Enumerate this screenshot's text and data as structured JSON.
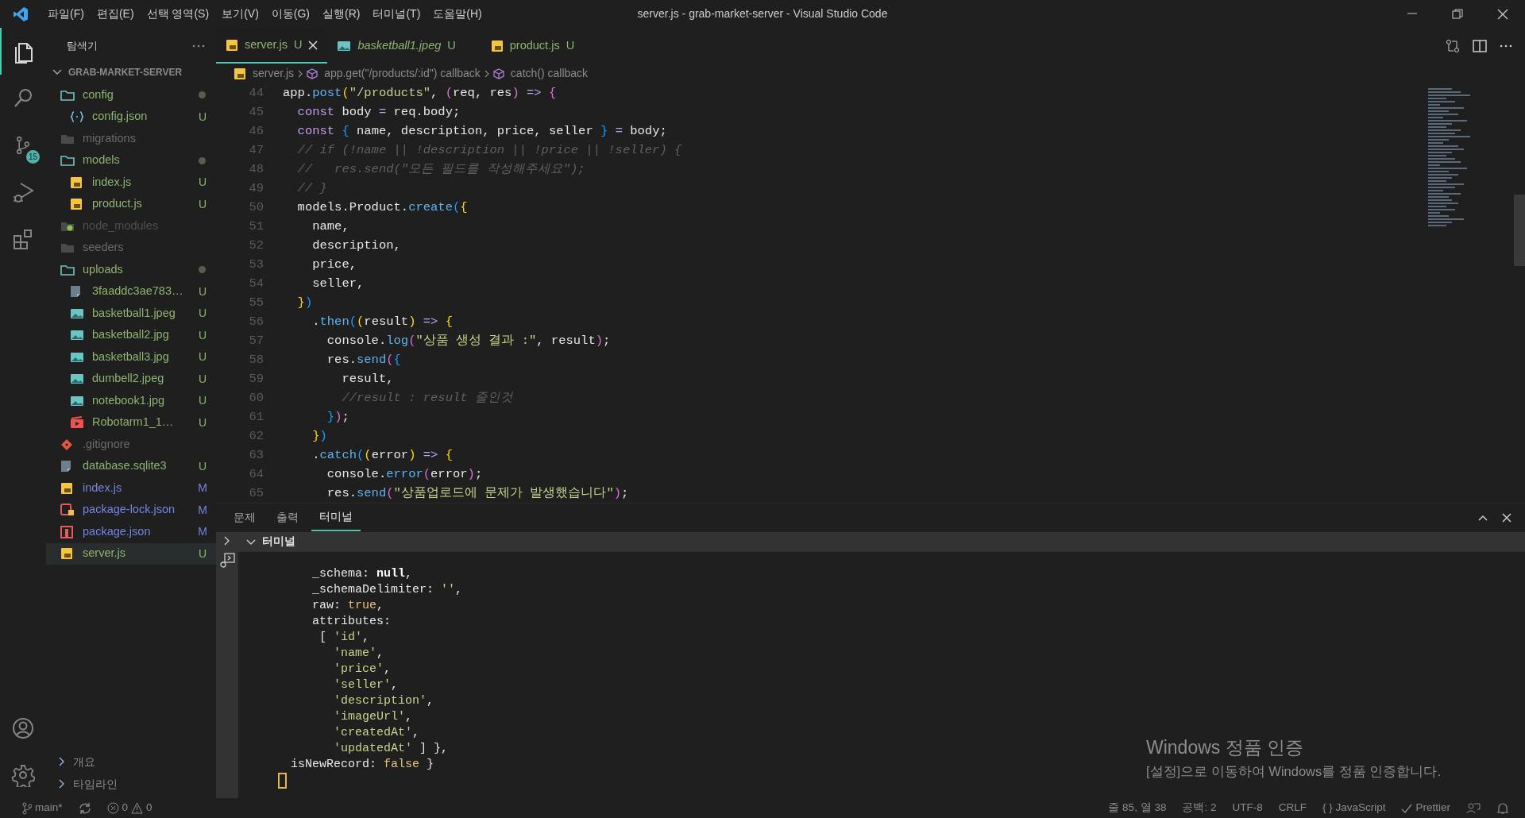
{
  "window": {
    "title": "server.js - grab-market-server - Visual Studio Code"
  },
  "menu": [
    "파일(F)",
    "편집(E)",
    "선택 영역(S)",
    "보기(V)",
    "이동(G)",
    "실행(R)",
    "터미널(T)",
    "도움말(H)"
  ],
  "activity_bar": {
    "items": [
      {
        "kind": "explorer",
        "selected": true
      },
      {
        "kind": "search",
        "selected": false
      },
      {
        "kind": "source-control",
        "selected": false,
        "badge": "15"
      },
      {
        "kind": "run-debug",
        "selected": false
      },
      {
        "kind": "extensions",
        "selected": false
      }
    ],
    "bottom": [
      {
        "kind": "account"
      },
      {
        "kind": "settings"
      }
    ]
  },
  "sidebar": {
    "title": "탐색기",
    "root": {
      "label": "GRAB-MARKET-SERVER",
      "expanded": true
    },
    "items": [
      {
        "name": "config",
        "kind": "folder",
        "expanded": true,
        "color": "#8db46f",
        "dot": true,
        "selected": false,
        "children": [
          {
            "name": "config.json",
            "kind": "json",
            "color": "#8db46f",
            "badge": "U",
            "dot": false,
            "selected": false
          }
        ]
      },
      {
        "name": "migrations",
        "kind": "folder",
        "expanded": false,
        "color": "#6a6a6a",
        "dot": false,
        "selected": false
      },
      {
        "name": "models",
        "kind": "folder",
        "expanded": true,
        "color": "#8db46f",
        "dot": true,
        "selected": false,
        "children": [
          {
            "name": "index.js",
            "kind": "js",
            "color": "#8db46f",
            "badge": "U",
            "dot": false,
            "selected": false
          },
          {
            "name": "product.js",
            "kind": "js",
            "color": "#8db46f",
            "badge": "U",
            "dot": false,
            "selected": false
          }
        ]
      },
      {
        "name": "node_modules",
        "kind": "node-folder",
        "expanded": false,
        "color": "#4f4f4f",
        "dot": false,
        "selected": false
      },
      {
        "name": "seeders",
        "kind": "folder",
        "expanded": false,
        "color": "#6a6a6a",
        "dot": false,
        "selected": false
      },
      {
        "name": "uploads",
        "kind": "folder",
        "expanded": true,
        "color": "#8db46f",
        "dot": true,
        "selected": false,
        "children": [
          {
            "name": "3faaddc3ae783…",
            "kind": "file",
            "color": "#8db46f",
            "badge": "U",
            "dot": false,
            "selected": false
          },
          {
            "name": "basketball1.jpeg",
            "kind": "image",
            "color": "#8db46f",
            "badge": "U",
            "dot": false,
            "selected": false
          },
          {
            "name": "basketball2.jpg",
            "kind": "image",
            "color": "#8db46f",
            "badge": "U",
            "dot": false,
            "selected": false
          },
          {
            "name": "basketball3.jpg",
            "kind": "image",
            "color": "#8db46f",
            "badge": "U",
            "dot": false,
            "selected": false
          },
          {
            "name": "dumbell2.jpeg",
            "kind": "image",
            "color": "#8db46f",
            "badge": "U",
            "dot": false,
            "selected": false
          },
          {
            "name": "notebook1.jpg",
            "kind": "image",
            "color": "#8db46f",
            "badge": "U",
            "dot": false,
            "selected": false
          },
          {
            "name": "Robotarm1_1…",
            "kind": "video",
            "color": "#8db46f",
            "badge": "U",
            "dot": false,
            "selected": false
          }
        ]
      },
      {
        "name": ".gitignore",
        "kind": "git",
        "color": "#6a6a6a",
        "dot": false,
        "selected": false
      },
      {
        "name": "database.sqlite3",
        "kind": "file",
        "color": "#8db46f",
        "badge": "U",
        "dot": false,
        "selected": false
      },
      {
        "name": "index.js",
        "kind": "js",
        "color": "#7484e0",
        "badge": "M",
        "dot": false,
        "selected": false
      },
      {
        "name": "package-lock.json",
        "kind": "lock",
        "color": "#7484e0",
        "badge": "M",
        "dot": false,
        "selected": false
      },
      {
        "name": "package.json",
        "kind": "npm",
        "color": "#7484e0",
        "badge": "M",
        "dot": false,
        "selected": false
      },
      {
        "name": "server.js",
        "kind": "js",
        "color": "#8db46f",
        "badge": "U",
        "dot": false,
        "selected": true
      }
    ],
    "sections": [
      {
        "label": "개요",
        "expanded": false
      },
      {
        "label": "타임라인",
        "expanded": false
      }
    ]
  },
  "tabs": [
    {
      "label": "server.js",
      "kind": "js",
      "badge": "U",
      "selected": true,
      "preview": false
    },
    {
      "label": "basketball1.jpeg",
      "kind": "image",
      "badge": "U",
      "selected": false,
      "preview": true
    },
    {
      "label": "product.js",
      "kind": "js",
      "badge": "U",
      "selected": false,
      "preview": false
    }
  ],
  "breadcrumb": [
    {
      "label": "server.js",
      "kind": "js"
    },
    {
      "label": "app.get(\"/products/:id\") callback",
      "kind": "method"
    },
    {
      "label": "catch() callback",
      "kind": "method"
    }
  ],
  "editor": {
    "lines": [
      {
        "number": "44",
        "text": "app.post(\"/products\", (req, res) => {"
      },
      {
        "number": "45",
        "text": "  const body = req.body;"
      },
      {
        "number": "46",
        "text": "  const { name, description, price, seller } = body;"
      },
      {
        "number": "47",
        "text": "  // if (!name || !description || !price || !seller) {"
      },
      {
        "number": "48",
        "text": "  //   res.send(\"모든 필드를 작성해주세요\");"
      },
      {
        "number": "49",
        "text": "  // }"
      },
      {
        "number": "50",
        "text": "  models.Product.create({"
      },
      {
        "number": "51",
        "text": "    name,"
      },
      {
        "number": "52",
        "text": "    description,"
      },
      {
        "number": "53",
        "text": "    price,"
      },
      {
        "number": "54",
        "text": "    seller,"
      },
      {
        "number": "55",
        "text": "  })"
      },
      {
        "number": "56",
        "text": "    .then((result) => {"
      },
      {
        "number": "57",
        "text": "      console.log(\"상품 생성 결과 :\", result);"
      },
      {
        "number": "58",
        "text": "      res.send({"
      },
      {
        "number": "59",
        "text": "        result,"
      },
      {
        "number": "60",
        "text": "        //result : result 줄인것"
      },
      {
        "number": "61",
        "text": "      });"
      },
      {
        "number": "62",
        "text": "    })"
      },
      {
        "number": "63",
        "text": "    .catch((error) => {"
      },
      {
        "number": "64",
        "text": "      console.error(error);"
      },
      {
        "number": "65",
        "text": "      res.send(\"상품업로드에 문제가 발생했습니다\");"
      }
    ]
  },
  "panel": {
    "tabs": [
      {
        "label": "문제",
        "selected": false
      },
      {
        "label": "출력",
        "selected": false
      },
      {
        "label": "터미널",
        "selected": true
      }
    ],
    "section": {
      "label": "터미널",
      "expanded": true
    },
    "terminal_lines": [
      "       _schema: null,",
      "       _schemaDelimiter: '',",
      "       raw: true,",
      "       attributes:",
      "        [ 'id',",
      "          'name',",
      "          'price',",
      "          'seller',",
      "          'description',",
      "          'imageUrl',",
      "          'createdAt',",
      "          'updatedAt' ] },",
      "    isNewRecord: false }"
    ]
  },
  "status_bar": {
    "branch": "main*",
    "errors": "0",
    "warnings": "0",
    "right": [
      {
        "kind": "text",
        "label": "줄 85, 열 38"
      },
      {
        "kind": "text",
        "label": "공백: 2"
      },
      {
        "kind": "text",
        "label": "UTF-8"
      },
      {
        "kind": "text",
        "label": "CRLF"
      },
      {
        "kind": "text",
        "label": "{ } JavaScript"
      },
      {
        "kind": "check",
        "label": "Prettier"
      },
      {
        "kind": "feedback"
      },
      {
        "kind": "bell"
      }
    ]
  },
  "activation_notice": {
    "title": "Windows 정품 인증",
    "message": "[설정]으로 이동하여 Windows를 정품 인증합니다."
  }
}
